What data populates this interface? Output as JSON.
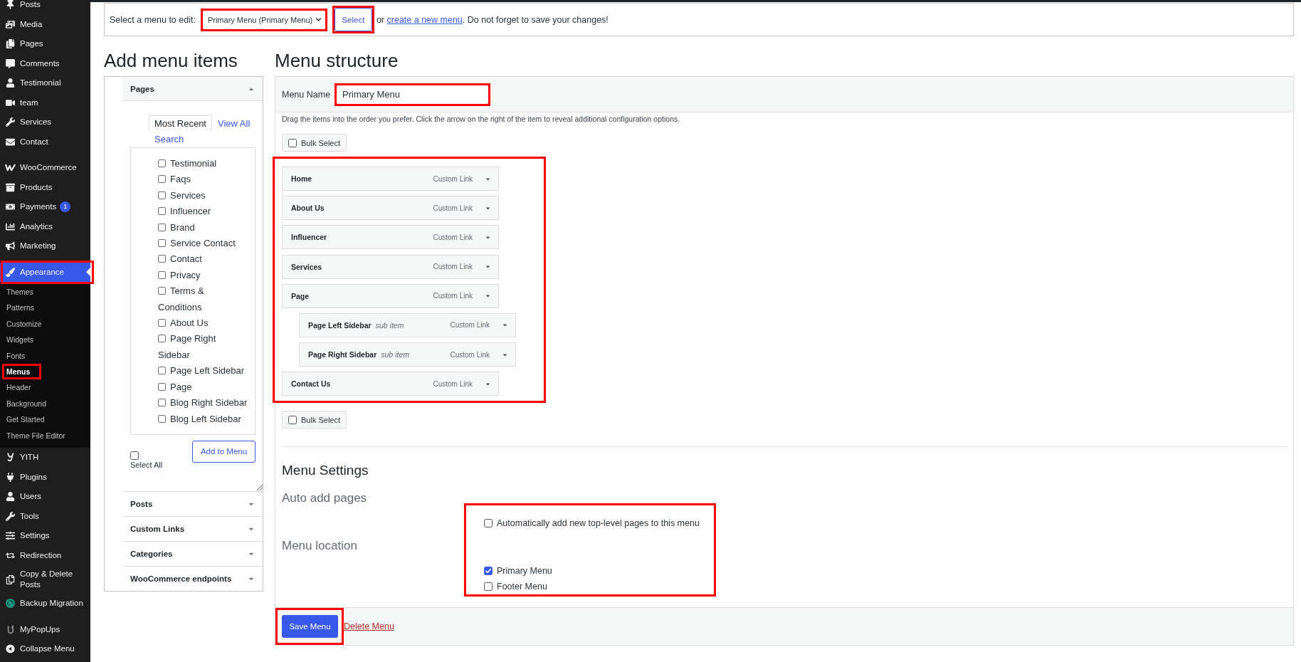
{
  "sidebar": {
    "groups": [
      [
        {
          "label": "Posts",
          "selected": false,
          "highlighted": false
        },
        {
          "label": "Media",
          "selected": false,
          "highlighted": false
        },
        {
          "label": "Pages",
          "selected": false,
          "highlighted": false
        },
        {
          "label": "Comments",
          "selected": false,
          "highlighted": false
        },
        {
          "label": "Testimonial",
          "selected": false,
          "highlighted": false
        },
        {
          "label": "team",
          "selected": false,
          "highlighted": false
        },
        {
          "label": "Services",
          "selected": false,
          "highlighted": false
        },
        {
          "label": "Contact",
          "selected": false,
          "highlighted": false
        }
      ],
      [
        {
          "label": "WooCommerce",
          "selected": false,
          "highlighted": false
        },
        {
          "label": "Products",
          "selected": false,
          "highlighted": false
        },
        {
          "label": "Payments",
          "badge": "1",
          "selected": false,
          "highlighted": false
        },
        {
          "label": "Analytics",
          "selected": false,
          "highlighted": false
        },
        {
          "label": "Marketing",
          "selected": false,
          "highlighted": false
        }
      ],
      [
        {
          "label": "Appearance",
          "selected": true,
          "highlighted": true,
          "children": [
            {
              "label": "Themes",
              "selected": false,
              "highlighted": false
            },
            {
              "label": "Patterns",
              "selected": false,
              "highlighted": false
            },
            {
              "label": "Customize",
              "selected": false,
              "highlighted": false
            },
            {
              "label": "Widgets",
              "selected": false,
              "highlighted": false
            },
            {
              "label": "Fonts",
              "selected": false,
              "highlighted": false
            },
            {
              "label": "Menus",
              "selected": true,
              "highlighted": true
            },
            {
              "label": "Header",
              "selected": false,
              "highlighted": false
            },
            {
              "label": "Background",
              "selected": false,
              "highlighted": false
            },
            {
              "label": "Get Started",
              "selected": false,
              "highlighted": false
            },
            {
              "label": "Theme File Editor",
              "selected": false,
              "highlighted": false
            }
          ]
        },
        {
          "label": "YITH",
          "selected": false,
          "highlighted": false
        },
        {
          "label": "Plugins",
          "selected": false,
          "highlighted": false
        },
        {
          "label": "Users",
          "selected": false,
          "highlighted": false
        },
        {
          "label": "Tools",
          "selected": false,
          "highlighted": false
        },
        {
          "label": "Settings",
          "selected": false,
          "highlighted": false
        },
        {
          "label": "Redirection",
          "selected": false,
          "highlighted": false
        },
        {
          "label": "Copy & Delete Posts",
          "selected": false,
          "highlighted": false
        },
        {
          "label": "Backup Migration",
          "selected": false,
          "highlighted": false
        }
      ],
      [
        {
          "label": "MyPopUps",
          "selected": false,
          "highlighted": false
        }
      ]
    ],
    "collapse": {
      "label": "Collapse Menu"
    }
  },
  "menu_picker": {
    "label": "Select a menu to edit:",
    "select": {
      "value": "Primary Menu (Primary Menu)",
      "highlighted": true
    },
    "button": {
      "label": "Select",
      "highlighted": true
    },
    "hint": {
      "before": "or",
      "link": "create a new menu",
      "after": ". Do not forget to save your changes!"
    }
  },
  "add_menu_items": {
    "title": "Add menu items",
    "sections": [
      {
        "title": "Pages",
        "expanded": true,
        "tabs": [
          {
            "label": "Most Recent",
            "selected": true
          },
          {
            "label": "View All",
            "selected": false
          },
          {
            "label": "Search",
            "selected": false
          }
        ],
        "items": [
          {
            "label": "Testimonial",
            "checked": false
          },
          {
            "label": "Faqs",
            "checked": false
          },
          {
            "label": "Services",
            "checked": false
          },
          {
            "label": "Influencer",
            "checked": false
          },
          {
            "label": "Brand",
            "checked": false
          },
          {
            "label": "Service Contact",
            "checked": false
          },
          {
            "label": "Contact",
            "checked": false
          },
          {
            "label": "Privacy",
            "checked": false
          },
          {
            "label": "Terms & Conditions",
            "checked": false
          },
          {
            "label": "About Us",
            "checked": false
          },
          {
            "label": "Page Right Sidebar",
            "checked": false
          },
          {
            "label": "Page Left Sidebar",
            "checked": false
          },
          {
            "label": "Page",
            "checked": false
          },
          {
            "label": "Blog Right Sidebar",
            "checked": false
          },
          {
            "label": "Blog Left Sidebar",
            "checked": false
          }
        ],
        "select_all": {
          "label": "Select All",
          "checked": false
        },
        "add_button": "Add to Menu"
      },
      {
        "title": "Posts",
        "expanded": false
      },
      {
        "title": "Custom Links",
        "expanded": false
      },
      {
        "title": "Categories",
        "expanded": false
      },
      {
        "title": "WooCommerce endpoints",
        "expanded": false
      }
    ]
  },
  "menu_structure": {
    "title": "Menu structure",
    "menu_name_label": "Menu Name",
    "menu_name": {
      "value": "Primary Menu",
      "highlighted": true
    },
    "instructions": "Drag the items into the order you prefer. Click the arrow on the right of the item to reveal additional configuration options.",
    "bulk_select_top": {
      "label": "Bulk Select",
      "checked": false
    },
    "items_highlighted": true,
    "items": [
      {
        "title": "Home",
        "type": "Custom Link"
      },
      {
        "title": "About Us",
        "type": "Custom Link"
      },
      {
        "title": "Influencer",
        "type": "Custom Link"
      },
      {
        "title": "Services",
        "type": "Custom Link"
      },
      {
        "title": "Page",
        "type": "Custom Link",
        "children": [
          {
            "title": "Page Left Sidebar",
            "note": "sub item",
            "type": "Custom Link"
          },
          {
            "title": "Page Right Sidebar",
            "note": "sub item",
            "type": "Custom Link"
          }
        ]
      },
      {
        "title": "Contact Us",
        "type": "Custom Link"
      }
    ],
    "bulk_select_bottom": {
      "label": "Bulk Select",
      "checked": false
    },
    "settings": {
      "title": "Menu Settings",
      "highlighted": true,
      "groups": [
        {
          "legend": "Auto add pages",
          "options": [
            {
              "label": "Automatically add new top-level pages to this menu",
              "checked": false
            }
          ]
        },
        {
          "legend": "Menu location",
          "options": [
            {
              "label": "Primary Menu",
              "checked": true
            },
            {
              "label": "Footer Menu",
              "checked": false
            }
          ]
        }
      ]
    },
    "save_button": {
      "label": "Save Menu",
      "highlighted": true
    },
    "delete_link": "Delete Menu"
  }
}
